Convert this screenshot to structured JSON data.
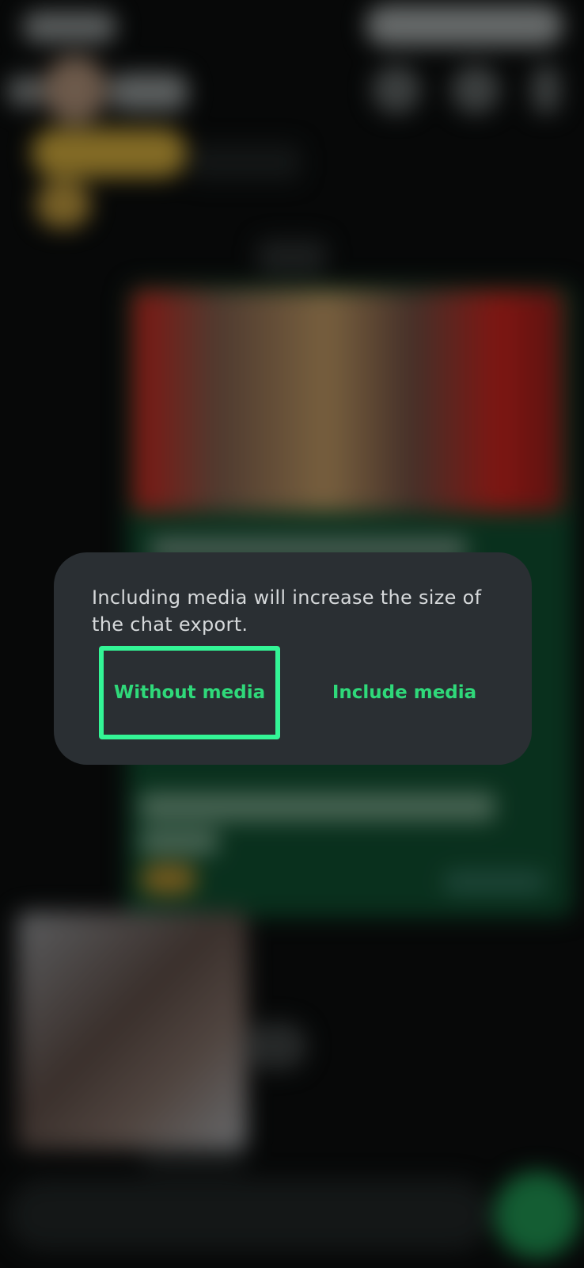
{
  "dialog": {
    "message": "Including media will increase the size of the chat export.",
    "without_media_label": "Without media",
    "include_media_label": "Include media"
  },
  "colors": {
    "dialog_background": "#2a2f33",
    "accent_green": "#2fd97a",
    "highlight_border": "#33f596"
  }
}
